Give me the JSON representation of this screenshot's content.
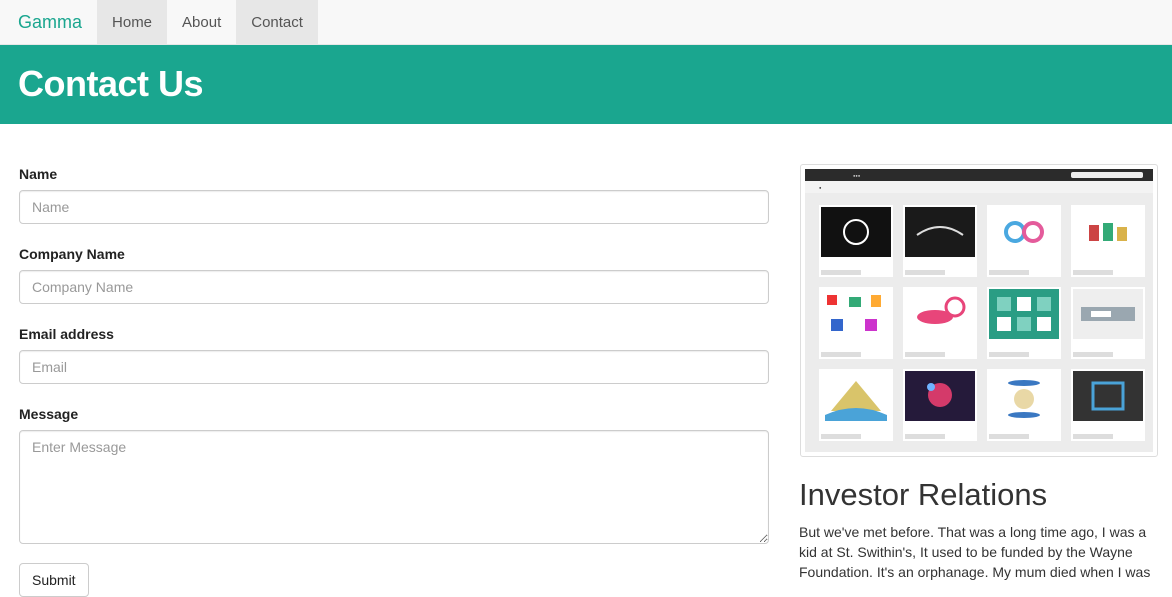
{
  "navbar": {
    "brand": "Gamma",
    "links": [
      {
        "label": "Home"
      },
      {
        "label": "About"
      },
      {
        "label": "Contact"
      }
    ]
  },
  "banner": {
    "title": "Contact Us"
  },
  "form": {
    "fields": [
      {
        "label": "Name",
        "placeholder": "Name"
      },
      {
        "label": "Company Name",
        "placeholder": "Company Name"
      },
      {
        "label": "Email address",
        "placeholder": "Email"
      },
      {
        "label": "Message",
        "placeholder": "Enter Message"
      }
    ],
    "submit_label": "Submit"
  },
  "sidebar": {
    "image_alt": "Dribbble screenshot",
    "heading": "Investor Relations",
    "text": "But we've met before. That was a long time ago, I was a kid at St. Swithin's, It used to be funded by the Wayne Foundation. It's an orphanage. My mum died when I was"
  },
  "colors": {
    "brand": "#1aa68f",
    "banner_bg": "#1aa68f",
    "nav_bg": "#f8f8f8",
    "nav_active_bg": "#e7e7e7"
  }
}
